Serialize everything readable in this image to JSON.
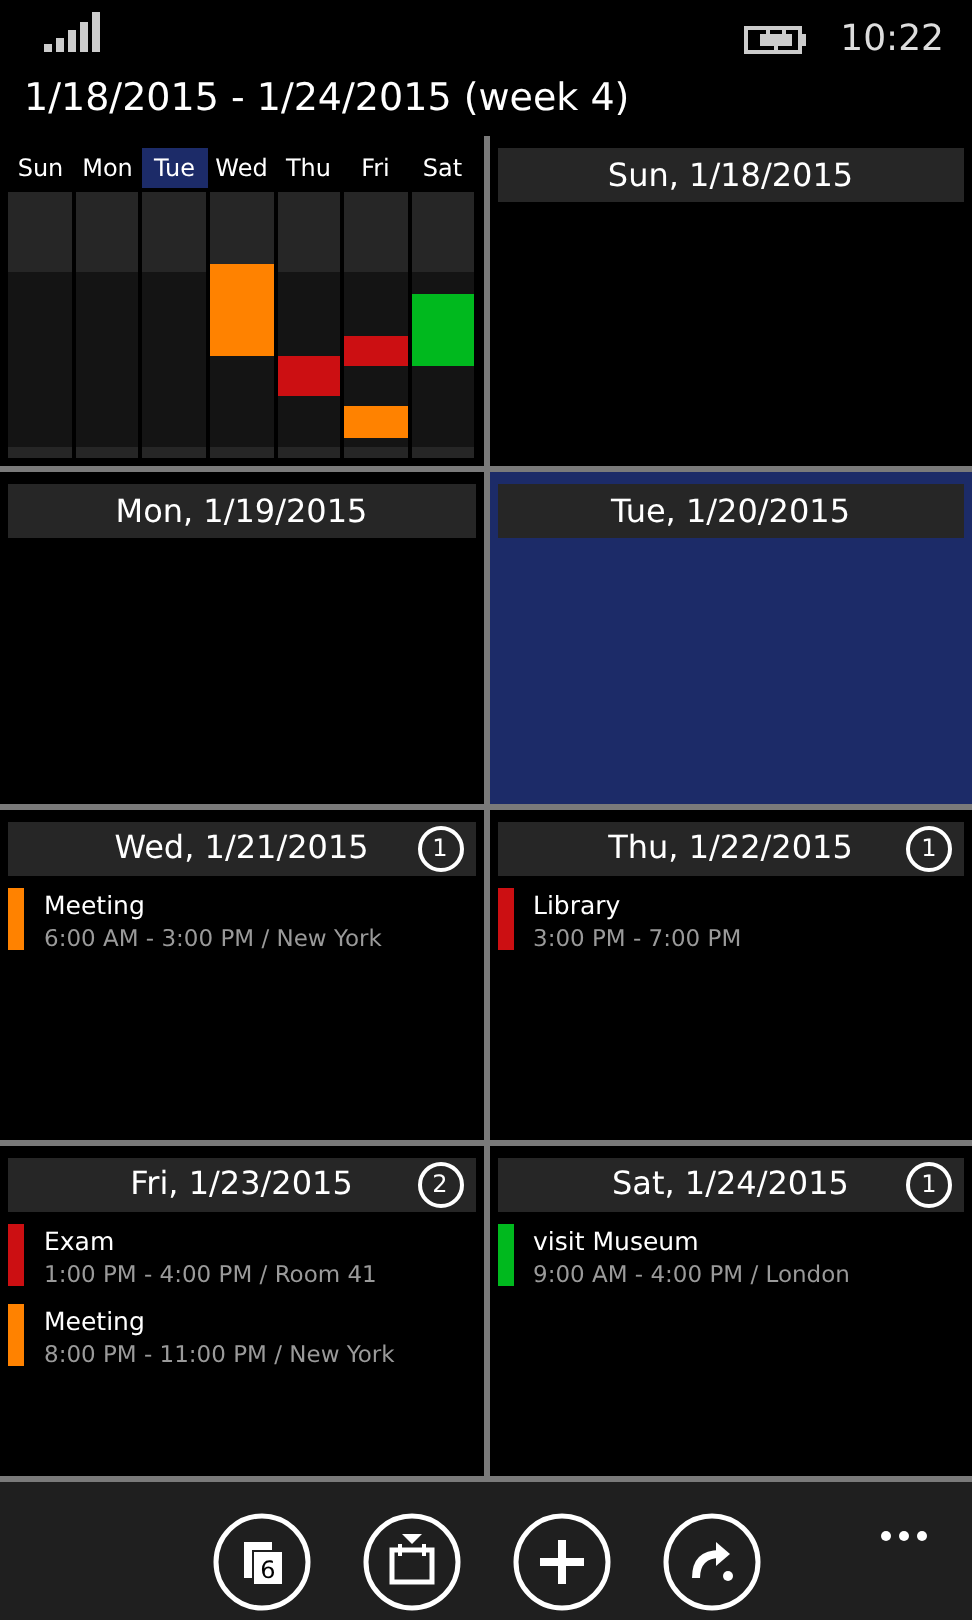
{
  "status_bar": {
    "time": "10:22"
  },
  "title": "1/18/2015 - 1/24/2015 (week 4)",
  "week_overview": {
    "days": [
      {
        "label": "Sun",
        "selected": false
      },
      {
        "label": "Mon",
        "selected": false
      },
      {
        "label": "Tue",
        "selected": true
      },
      {
        "label": "Wed",
        "selected": false
      },
      {
        "label": "Thu",
        "selected": false
      },
      {
        "label": "Fri",
        "selected": false
      },
      {
        "label": "Sat",
        "selected": false
      }
    ]
  },
  "days": [
    {
      "date": "Sun, 1/18/2015",
      "selected": false
    },
    {
      "date": "Mon, 1/19/2015",
      "selected": false
    },
    {
      "date": "Tue, 1/20/2015",
      "selected": true
    },
    {
      "date": "Wed, 1/21/2015",
      "selected": false,
      "count": "1",
      "events": [
        {
          "title": "Meeting",
          "time": "6:00 AM - 3:00 PM / New York",
          "color": "#ff8200"
        }
      ]
    },
    {
      "date": "Thu, 1/22/2015",
      "selected": false,
      "count": "1",
      "events": [
        {
          "title": "Library",
          "time": "3:00 PM - 7:00 PM",
          "color": "#cc0f12"
        }
      ]
    },
    {
      "date": "Fri, 1/23/2015",
      "selected": false,
      "count": "2",
      "events": [
        {
          "title": "Exam",
          "time": "1:00 PM - 4:00 PM / Room 41",
          "color": "#cc0f12"
        },
        {
          "title": "Meeting",
          "time": "8:00 PM - 11:00 PM / New York",
          "color": "#ff8200"
        }
      ]
    },
    {
      "date": "Sat, 1/24/2015",
      "selected": false,
      "count": "1",
      "events": [
        {
          "title": "visit Museum",
          "time": "9:00 AM - 4:00 PM / London",
          "color": "#00b91e"
        }
      ]
    }
  ],
  "app_bar": {
    "buttons": [
      {
        "kind": "today",
        "number": "6"
      },
      {
        "kind": "goto"
      },
      {
        "kind": "add"
      },
      {
        "kind": "redo"
      }
    ]
  }
}
